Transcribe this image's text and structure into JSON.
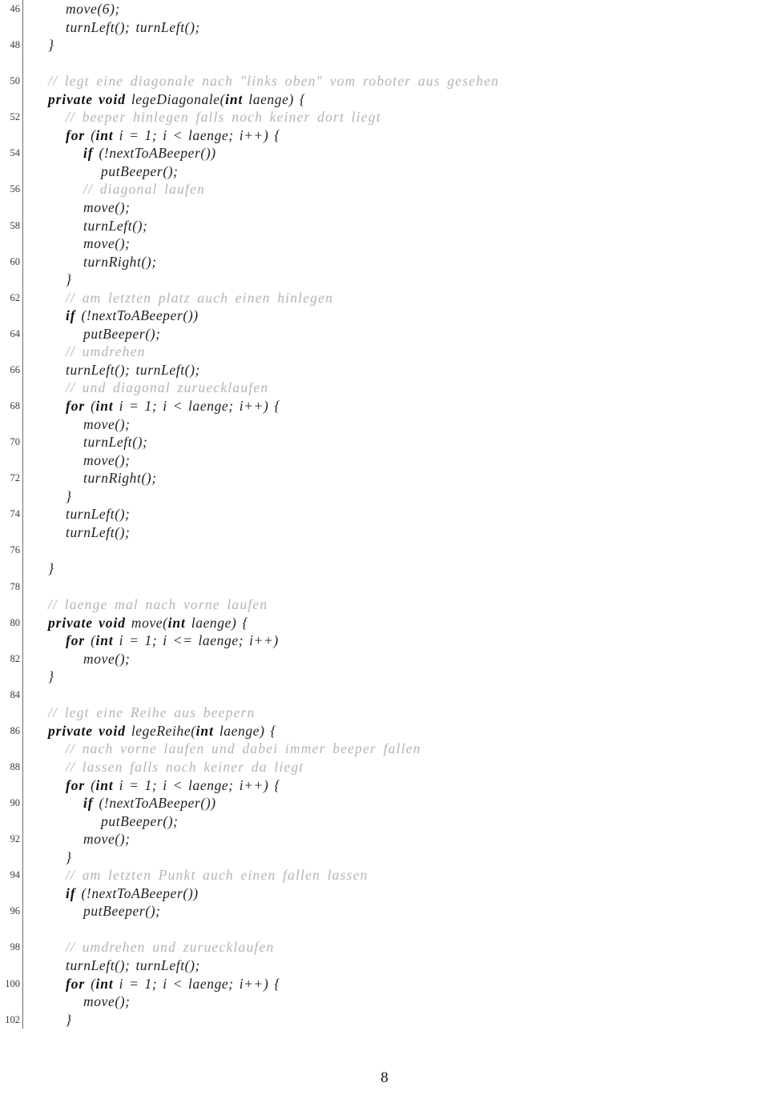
{
  "document": {
    "kind": "latex-code-listing",
    "language": "Java (Karel robot)",
    "page_number": "8",
    "gutter_number_parity": "even-lines-only",
    "colors": {
      "text": "#1a1a1a",
      "comment": "#b4b4b4",
      "line_number": "#3a3a3a",
      "rule": "#6a6a6a",
      "background": "#ffffff"
    }
  },
  "listing": {
    "first_line_number": 46,
    "last_line_number": 102,
    "lines": [
      {
        "n": 46,
        "indent": 2,
        "parts": [
          {
            "t": "id",
            "s": "move(6);"
          }
        ]
      },
      {
        "n": 47,
        "indent": 2,
        "parts": [
          {
            "t": "id",
            "s": "turnLeft();  turnLeft();"
          }
        ]
      },
      {
        "n": 48,
        "indent": 1,
        "parts": [
          {
            "t": "punc",
            "s": "}"
          }
        ]
      },
      {
        "n": 49,
        "indent": 0,
        "parts": []
      },
      {
        "n": 50,
        "indent": 1,
        "parts": [
          {
            "t": "cmt",
            "s": "// legt eine diagonale nach \"links oben\" vom roboter aus gesehen"
          }
        ]
      },
      {
        "n": 51,
        "indent": 1,
        "parts": [
          {
            "t": "kw",
            "s": "private void"
          },
          {
            "t": "id",
            "s": " legeDiagonale("
          },
          {
            "t": "kw",
            "s": "int"
          },
          {
            "t": "id",
            "s": " laenge) {"
          }
        ]
      },
      {
        "n": 52,
        "indent": 2,
        "parts": [
          {
            "t": "cmt",
            "s": "// beeper hinlegen falls noch keiner dort liegt"
          }
        ]
      },
      {
        "n": 53,
        "indent": 2,
        "parts": [
          {
            "t": "kw",
            "s": "for"
          },
          {
            "t": "id",
            "s": " ("
          },
          {
            "t": "kw",
            "s": "int"
          },
          {
            "t": "id",
            "s": " i = 1; i < laenge; i++) {"
          }
        ]
      },
      {
        "n": 54,
        "indent": 3,
        "parts": [
          {
            "t": "kw",
            "s": "if"
          },
          {
            "t": "id",
            "s": " (!nextToABeeper())"
          }
        ]
      },
      {
        "n": 55,
        "indent": 4,
        "parts": [
          {
            "t": "id",
            "s": "putBeeper();"
          }
        ]
      },
      {
        "n": 56,
        "indent": 3,
        "parts": [
          {
            "t": "cmt",
            "s": "// diagonal laufen"
          }
        ]
      },
      {
        "n": 57,
        "indent": 3,
        "parts": [
          {
            "t": "id",
            "s": "move();"
          }
        ]
      },
      {
        "n": 58,
        "indent": 3,
        "parts": [
          {
            "t": "id",
            "s": "turnLeft();"
          }
        ]
      },
      {
        "n": 59,
        "indent": 3,
        "parts": [
          {
            "t": "id",
            "s": "move();"
          }
        ]
      },
      {
        "n": 60,
        "indent": 3,
        "parts": [
          {
            "t": "id",
            "s": "turnRight();"
          }
        ]
      },
      {
        "n": 61,
        "indent": 2,
        "parts": [
          {
            "t": "punc",
            "s": "}"
          }
        ]
      },
      {
        "n": 62,
        "indent": 2,
        "parts": [
          {
            "t": "cmt",
            "s": "// am letzten platz auch einen hinlegen"
          }
        ]
      },
      {
        "n": 63,
        "indent": 2,
        "parts": [
          {
            "t": "kw",
            "s": "if"
          },
          {
            "t": "id",
            "s": " (!nextToABeeper())"
          }
        ]
      },
      {
        "n": 64,
        "indent": 3,
        "parts": [
          {
            "t": "id",
            "s": "putBeeper();"
          }
        ]
      },
      {
        "n": 65,
        "indent": 2,
        "parts": [
          {
            "t": "cmt",
            "s": "// umdrehen"
          }
        ]
      },
      {
        "n": 66,
        "indent": 2,
        "parts": [
          {
            "t": "id",
            "s": "turnLeft();  turnLeft();"
          }
        ]
      },
      {
        "n": 67,
        "indent": 2,
        "parts": [
          {
            "t": "cmt",
            "s": "// und diagonal zuruecklaufen"
          }
        ]
      },
      {
        "n": 68,
        "indent": 2,
        "parts": [
          {
            "t": "kw",
            "s": "for"
          },
          {
            "t": "id",
            "s": " ("
          },
          {
            "t": "kw",
            "s": "int"
          },
          {
            "t": "id",
            "s": " i = 1; i < laenge; i++) {"
          }
        ]
      },
      {
        "n": 69,
        "indent": 3,
        "parts": [
          {
            "t": "id",
            "s": "move();"
          }
        ]
      },
      {
        "n": 70,
        "indent": 3,
        "parts": [
          {
            "t": "id",
            "s": "turnLeft();"
          }
        ]
      },
      {
        "n": 71,
        "indent": 3,
        "parts": [
          {
            "t": "id",
            "s": "move();"
          }
        ]
      },
      {
        "n": 72,
        "indent": 3,
        "parts": [
          {
            "t": "id",
            "s": "turnRight();"
          }
        ]
      },
      {
        "n": 73,
        "indent": 2,
        "parts": [
          {
            "t": "punc",
            "s": "}"
          }
        ]
      },
      {
        "n": 74,
        "indent": 2,
        "parts": [
          {
            "t": "id",
            "s": "turnLeft();"
          }
        ]
      },
      {
        "n": 75,
        "indent": 2,
        "parts": [
          {
            "t": "id",
            "s": "turnLeft();"
          }
        ]
      },
      {
        "n": 76,
        "indent": 0,
        "parts": []
      },
      {
        "n": 77,
        "indent": 1,
        "parts": [
          {
            "t": "punc",
            "s": "}"
          }
        ]
      },
      {
        "n": 78,
        "indent": 0,
        "parts": []
      },
      {
        "n": 79,
        "indent": 1,
        "parts": [
          {
            "t": "cmt",
            "s": "// laenge mal nach vorne laufen"
          }
        ]
      },
      {
        "n": 80,
        "indent": 1,
        "parts": [
          {
            "t": "kw",
            "s": "private void"
          },
          {
            "t": "id",
            "s": " move("
          },
          {
            "t": "kw",
            "s": "int"
          },
          {
            "t": "id",
            "s": " laenge) {"
          }
        ]
      },
      {
        "n": 81,
        "indent": 2,
        "parts": [
          {
            "t": "kw",
            "s": "for"
          },
          {
            "t": "id",
            "s": " ("
          },
          {
            "t": "kw",
            "s": "int"
          },
          {
            "t": "id",
            "s": " i = 1; i <= laenge; i++)"
          }
        ]
      },
      {
        "n": 82,
        "indent": 3,
        "parts": [
          {
            "t": "id",
            "s": "move();"
          }
        ]
      },
      {
        "n": 83,
        "indent": 1,
        "parts": [
          {
            "t": "punc",
            "s": "}"
          }
        ]
      },
      {
        "n": 84,
        "indent": 0,
        "parts": []
      },
      {
        "n": 85,
        "indent": 1,
        "parts": [
          {
            "t": "cmt",
            "s": "// legt eine Reihe aus beepern"
          }
        ]
      },
      {
        "n": 86,
        "indent": 1,
        "parts": [
          {
            "t": "kw",
            "s": "private void"
          },
          {
            "t": "id",
            "s": " legeReihe("
          },
          {
            "t": "kw",
            "s": "int"
          },
          {
            "t": "id",
            "s": " laenge) {"
          }
        ]
      },
      {
        "n": 87,
        "indent": 2,
        "parts": [
          {
            "t": "cmt",
            "s": "// nach vorne laufen und dabei immer beeper fallen"
          }
        ]
      },
      {
        "n": 88,
        "indent": 2,
        "parts": [
          {
            "t": "cmt",
            "s": "// lassen falls noch keiner da liegt"
          }
        ]
      },
      {
        "n": 89,
        "indent": 2,
        "parts": [
          {
            "t": "kw",
            "s": "for"
          },
          {
            "t": "id",
            "s": " ("
          },
          {
            "t": "kw",
            "s": "int"
          },
          {
            "t": "id",
            "s": " i = 1; i < laenge; i++) {"
          }
        ]
      },
      {
        "n": 90,
        "indent": 3,
        "parts": [
          {
            "t": "kw",
            "s": "if"
          },
          {
            "t": "id",
            "s": " (!nextToABeeper())"
          }
        ]
      },
      {
        "n": 91,
        "indent": 4,
        "parts": [
          {
            "t": "id",
            "s": "putBeeper();"
          }
        ]
      },
      {
        "n": 92,
        "indent": 3,
        "parts": [
          {
            "t": "id",
            "s": "move();"
          }
        ]
      },
      {
        "n": 93,
        "indent": 2,
        "parts": [
          {
            "t": "punc",
            "s": "}"
          }
        ]
      },
      {
        "n": 94,
        "indent": 2,
        "parts": [
          {
            "t": "cmt",
            "s": "// am letzten Punkt auch einen fallen lassen"
          }
        ]
      },
      {
        "n": 95,
        "indent": 2,
        "parts": [
          {
            "t": "kw",
            "s": "if"
          },
          {
            "t": "id",
            "s": " (!nextToABeeper())"
          }
        ]
      },
      {
        "n": 96,
        "indent": 3,
        "parts": [
          {
            "t": "id",
            "s": "putBeeper();"
          }
        ]
      },
      {
        "n": 97,
        "indent": 0,
        "parts": []
      },
      {
        "n": 98,
        "indent": 2,
        "parts": [
          {
            "t": "cmt",
            "s": "// umdrehen und zuruecklaufen"
          }
        ]
      },
      {
        "n": 99,
        "indent": 2,
        "parts": [
          {
            "t": "id",
            "s": "turnLeft();  turnLeft();"
          }
        ]
      },
      {
        "n": 100,
        "indent": 2,
        "parts": [
          {
            "t": "kw",
            "s": "for"
          },
          {
            "t": "id",
            "s": " ("
          },
          {
            "t": "kw",
            "s": "int"
          },
          {
            "t": "id",
            "s": " i = 1; i < laenge; i++) {"
          }
        ]
      },
      {
        "n": 101,
        "indent": 3,
        "parts": [
          {
            "t": "id",
            "s": "move();"
          }
        ]
      },
      {
        "n": 102,
        "indent": 2,
        "parts": [
          {
            "t": "punc",
            "s": "}"
          }
        ]
      }
    ]
  },
  "footer": {
    "page_number": "8"
  }
}
